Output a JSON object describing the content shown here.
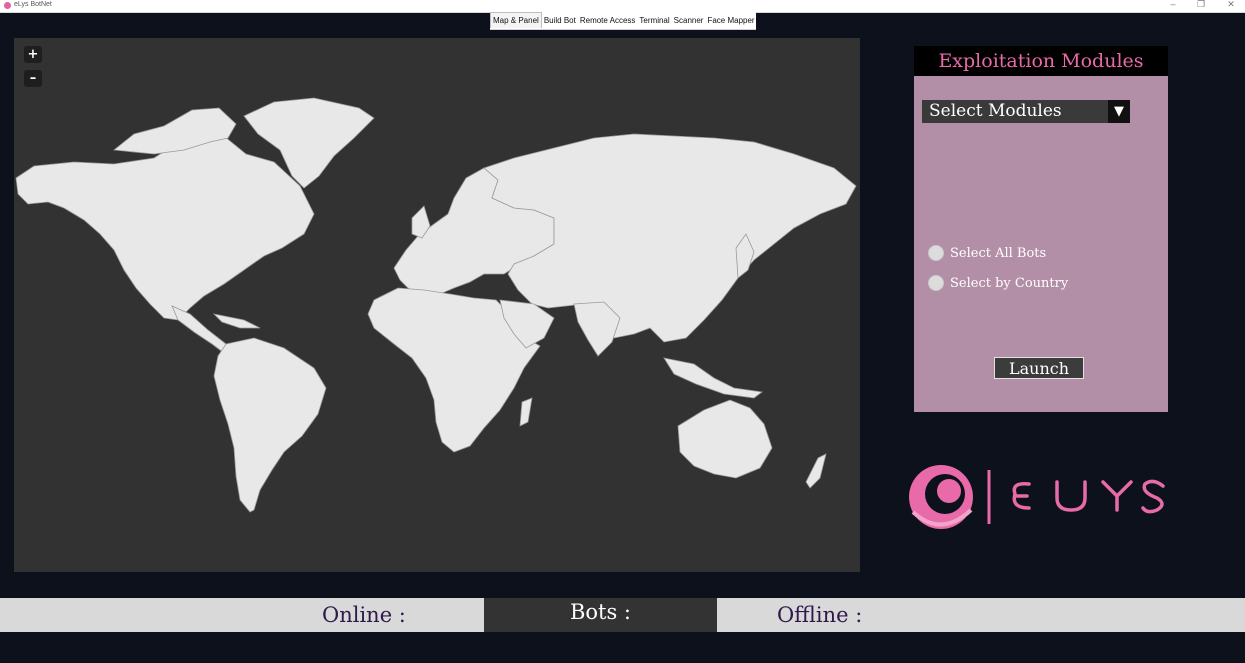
{
  "window": {
    "title": "eLys BotNet",
    "controls": {
      "minimize": "–",
      "maximize": "❐",
      "close": "✕"
    }
  },
  "tabs": [
    "Map & Panel",
    "Build Bot",
    "Remote Access",
    "Terminal",
    "Scanner",
    "Face Mapper"
  ],
  "map": {
    "zoom_in": "+",
    "zoom_out": "–"
  },
  "panel": {
    "title": "Exploitation Modules",
    "select": {
      "value": "Select Modules",
      "icon": "chevron-down-icon"
    },
    "options": [
      "Select All Bots",
      "Select by Country"
    ],
    "launch": "Launch"
  },
  "logo": {
    "text": "ELYS"
  },
  "status": {
    "online": "Online :",
    "bots": "Bots :",
    "offline": "Offline :"
  },
  "colors": {
    "background": "#0d111b",
    "map_water": "#323232",
    "map_land": "#e8e8e8",
    "panel": "#b38fa7",
    "accent_pink": "#e86aa9"
  }
}
